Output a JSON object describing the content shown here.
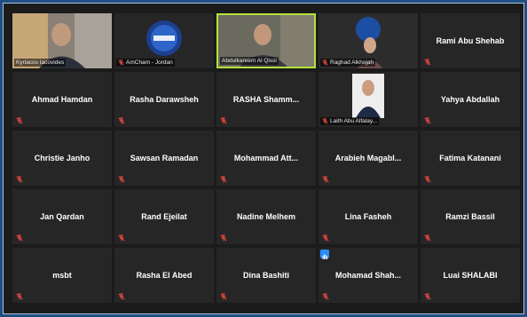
{
  "participants": [
    {
      "name": "Kyriacos Iacovides",
      "kind": "video"
    },
    {
      "name": "AmCham - Jordan",
      "kind": "logo"
    },
    {
      "name": "Abdulkareem Al Qissi",
      "kind": "video",
      "active": true
    },
    {
      "name": "Raghad Alkhojah",
      "kind": "video"
    },
    {
      "name": "Rami Abu Shehab",
      "kind": "name"
    },
    {
      "name": "Ahmad Hamdan",
      "kind": "name"
    },
    {
      "name": "Rasha Darawsheh",
      "kind": "name"
    },
    {
      "name": "RASHA  Shamm...",
      "kind": "name"
    },
    {
      "name": "Laith Abu Alfalay...",
      "kind": "video"
    },
    {
      "name": "Yahya Abdallah",
      "kind": "name"
    },
    {
      "name": "Christie Janho",
      "kind": "name"
    },
    {
      "name": "Sawsan Ramadan",
      "kind": "name"
    },
    {
      "name": "Mohammad  Att...",
      "kind": "name"
    },
    {
      "name": "Arabieh  Magabl...",
      "kind": "name"
    },
    {
      "name": "Fatima Katanani",
      "kind": "name"
    },
    {
      "name": "Jan Qardan",
      "kind": "name"
    },
    {
      "name": "Rand Ejeilat",
      "kind": "name"
    },
    {
      "name": "Nadine Melhem",
      "kind": "name"
    },
    {
      "name": "Lina Fasheh",
      "kind": "name"
    },
    {
      "name": "Ramzi Bassil",
      "kind": "name"
    },
    {
      "name": "msbt",
      "kind": "name"
    },
    {
      "name": "Rasha El Abed",
      "kind": "name"
    },
    {
      "name": "Dina Bashiti",
      "kind": "name"
    },
    {
      "name": "Mohamad  Shah...",
      "kind": "name",
      "hand_raised": true
    },
    {
      "name": "Luai SHALABI",
      "kind": "name"
    }
  ],
  "colors": {
    "active_border": "#b4e23a",
    "muted_mic": "#e0463c",
    "raise_hand": "#2d8cff"
  }
}
